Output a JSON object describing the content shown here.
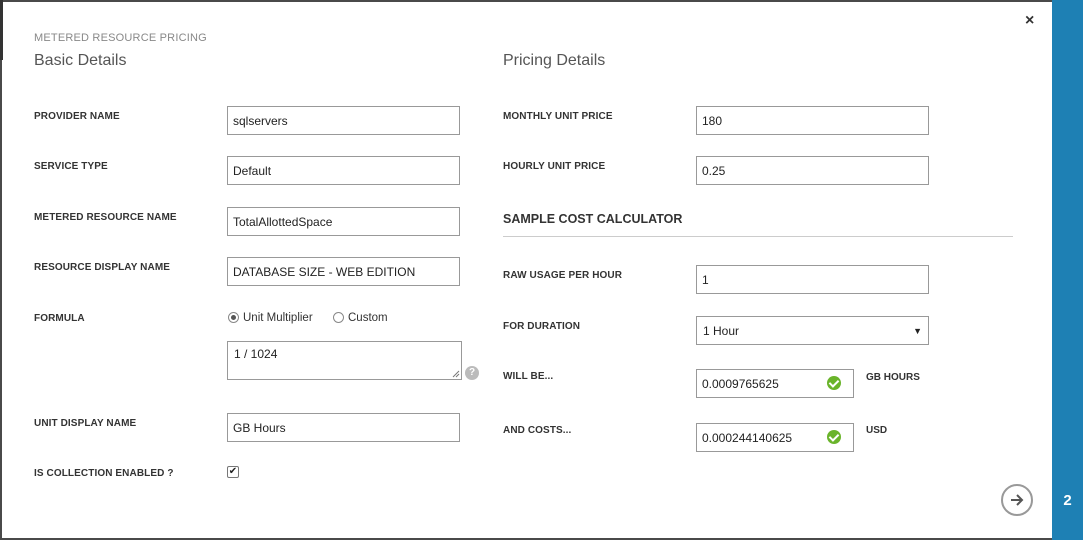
{
  "dialog": {
    "eyebrow": "METERED RESOURCE PRICING",
    "step_number": "2",
    "close_icon": "close-icon",
    "next_icon": "arrow-right-circle-icon"
  },
  "basic": {
    "title": "Basic Details",
    "provider_name_label": "PROVIDER NAME",
    "provider_name_value": "sqlservers",
    "service_type_label": "SERVICE TYPE",
    "service_type_value": "Default",
    "metered_resource_name_label": "METERED RESOURCE NAME",
    "metered_resource_name_value": "TotalAllottedSpace",
    "resource_display_name_label": "RESOURCE DISPLAY NAME",
    "resource_display_name_value": "DATABASE SIZE - WEB EDITION",
    "formula_label": "FORMULA",
    "formula_option_unit": "Unit Multiplier",
    "formula_option_custom": "Custom",
    "formula_selected": "Unit Multiplier",
    "formula_value": "1 / 1024",
    "unit_display_name_label": "UNIT DISPLAY NAME",
    "unit_display_name_value": "GB Hours",
    "collection_label": "IS COLLECTION ENABLED ?",
    "collection_checked": true
  },
  "pricing": {
    "title": "Pricing Details",
    "monthly_label": "MONTHLY UNIT PRICE",
    "monthly_value": "180",
    "hourly_label": "HOURLY UNIT PRICE",
    "hourly_value": "0.25"
  },
  "calculator": {
    "title": "SAMPLE COST CALCULATOR",
    "raw_usage_label": "RAW USAGE PER HOUR",
    "raw_usage_value": "1",
    "duration_label": "FOR DURATION",
    "duration_value": "1 Hour",
    "will_be_label": "WILL BE...",
    "will_be_value": "0.0009765625",
    "will_be_unit": "GB HOURS",
    "costs_label": "AND COSTS...",
    "costs_value": "0.000244140625",
    "costs_unit": "USD"
  },
  "colors": {
    "rail": "#1e80b4",
    "ok": "#6ab42b"
  }
}
